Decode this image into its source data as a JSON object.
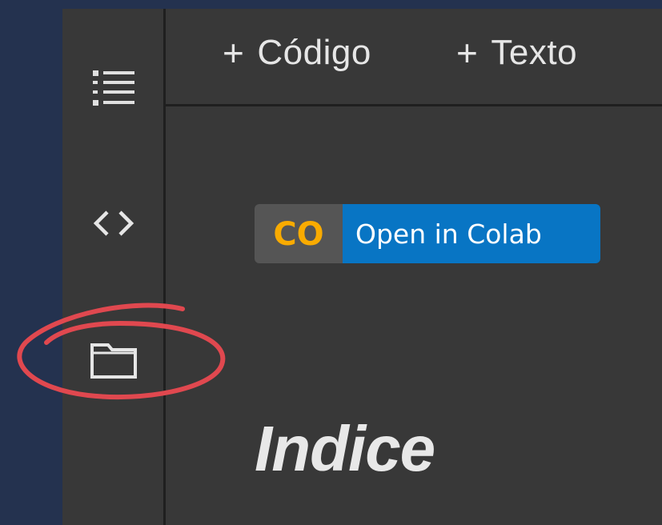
{
  "sidebar": {
    "items": [
      {
        "icon": "table-of-contents-icon"
      },
      {
        "icon": "code-snippets-icon"
      },
      {
        "icon": "folder-icon"
      }
    ]
  },
  "toolbar": {
    "add_code_plus": "+",
    "add_code_label": "Código",
    "add_text_plus": "+",
    "add_text_label": "Texto"
  },
  "notebook": {
    "colab_badge": {
      "logo_text": "CO",
      "label": "Open in Colab"
    },
    "heading": "Indice"
  },
  "colors": {
    "page_background": "#24324f",
    "panel_background": "#383838",
    "divider": "#1f1f1f",
    "badge_blue": "#0875c4",
    "badge_logo_bg": "#555555",
    "colab_orange": "#f9ab00",
    "annotation_red": "#e0484f"
  }
}
